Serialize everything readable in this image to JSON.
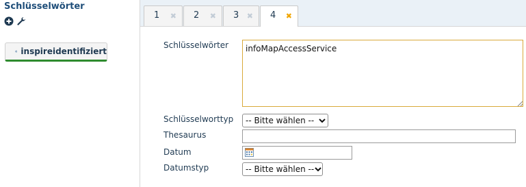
{
  "sidebar": {
    "title": "Schlüsselwörter",
    "icons": [
      "add-circle-icon",
      "wrench-icon"
    ],
    "tag": {
      "label": "inspireidentifiziert",
      "icon": "gear-icon"
    }
  },
  "tabs": [
    {
      "label": "1",
      "active": false
    },
    {
      "label": "2",
      "active": false
    },
    {
      "label": "3",
      "active": false
    },
    {
      "label": "4",
      "active": true
    }
  ],
  "tab_close_glyph": "✖",
  "form": {
    "keywords_label": "Schlüsselwörter",
    "keywords_value": "infoMapAccessService",
    "keyword_type_label": "Schlüsselworttyp",
    "keyword_type_value": "-- Bitte wählen --",
    "thesaurus_label": "Thesaurus",
    "thesaurus_value": "",
    "date_label": "Datum",
    "date_value": "",
    "date_type_label": "Datumstyp",
    "date_type_value": "-- Bitte wählen --"
  },
  "colors": {
    "accent_green": "#2e8b2e",
    "focus_border": "#d9a93a",
    "active_close": "#f0a500",
    "text": "#1f3a52"
  }
}
